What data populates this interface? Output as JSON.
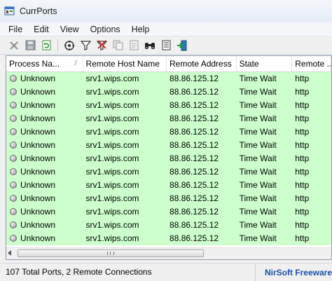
{
  "window": {
    "title": "CurrPorts"
  },
  "menu": [
    "File",
    "Edit",
    "View",
    "Options",
    "Help"
  ],
  "toolbar": {
    "icons": [
      "close-connections-icon",
      "save-icon",
      "refresh-icon",
      "properties-icon",
      "filter-icon",
      "remove-filter-icon",
      "copy-icon",
      "report-icon",
      "find-icon",
      "html-report-icon",
      "exit-icon"
    ]
  },
  "table": {
    "columns": [
      "Process Na...",
      "Remote Host Name",
      "Remote Address",
      "State",
      "Remote ..."
    ],
    "sort_indicator": "/",
    "rows": [
      [
        "Unknown",
        "srv1.wips.com",
        "88.86.125.12",
        "Time Wait",
        "http"
      ],
      [
        "Unknown",
        "srv1.wips.com",
        "88.86.125.12",
        "Time Wait",
        "http"
      ],
      [
        "Unknown",
        "srv1.wips.com",
        "88.86.125.12",
        "Time Wait",
        "http"
      ],
      [
        "Unknown",
        "srv1.wips.com",
        "88.86.125.12",
        "Time Wait",
        "http"
      ],
      [
        "Unknown",
        "srv1.wips.com",
        "88.86.125.12",
        "Time Wait",
        "http"
      ],
      [
        "Unknown",
        "srv1.wips.com",
        "88.86.125.12",
        "Time Wait",
        "http"
      ],
      [
        "Unknown",
        "srv1.wips.com",
        "88.86.125.12",
        "Time Wait",
        "http"
      ],
      [
        "Unknown",
        "srv1.wips.com",
        "88.86.125.12",
        "Time Wait",
        "http"
      ],
      [
        "Unknown",
        "srv1.wips.com",
        "88.86.125.12",
        "Time Wait",
        "http"
      ],
      [
        "Unknown",
        "srv1.wips.com",
        "88.86.125.12",
        "Time Wait",
        "http"
      ],
      [
        "Unknown",
        "srv1.wips.com",
        "88.86.125.12",
        "Time Wait",
        "http"
      ],
      [
        "Unknown",
        "srv1.wips.com",
        "88.86.125.12",
        "Time Wait",
        "http"
      ],
      [
        "Unknown",
        "srv1.wips.com",
        "88.86.125.12",
        "Time Wait",
        "http"
      ]
    ],
    "row_color": "#ccffcc"
  },
  "status": {
    "text": "107 Total Ports, 2 Remote Connections",
    "link": "NirSoft Freeware"
  }
}
